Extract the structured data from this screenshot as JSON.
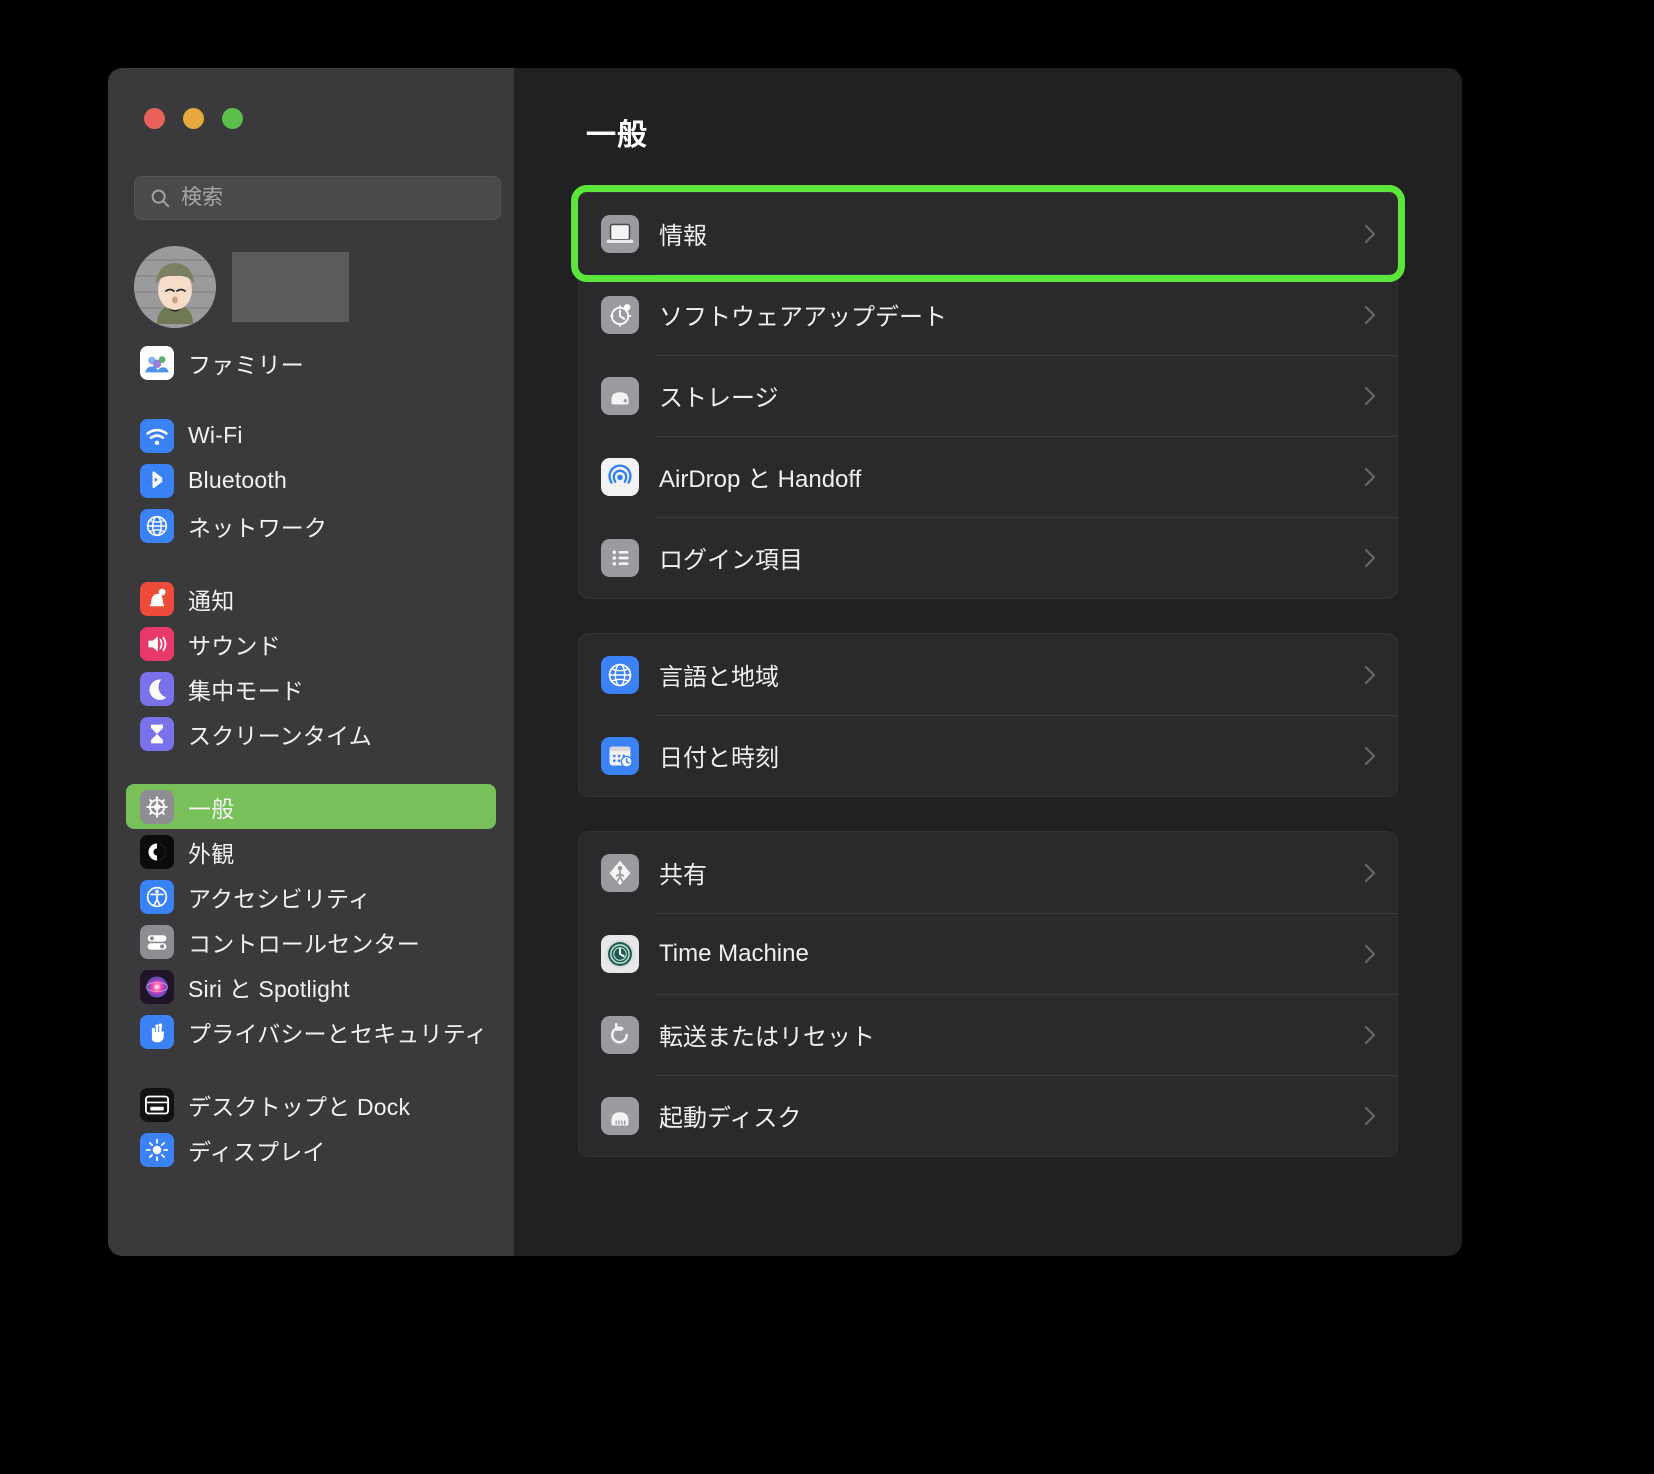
{
  "window": {
    "traffic_lights": [
      {
        "name": "close",
        "color": "#e8615a"
      },
      {
        "name": "minimize",
        "color": "#e7a93d"
      },
      {
        "name": "zoom",
        "color": "#5cbf49"
      }
    ]
  },
  "sidebar": {
    "search": {
      "placeholder": "検索",
      "value": "",
      "icon": "search-icon"
    },
    "account": {
      "avatar_icon": "user-avatar",
      "name_redacted": true
    },
    "groups": [
      {
        "items": [
          {
            "label": "ファミリー",
            "icon": "family-icon",
            "color": "#ffffff",
            "selected": false
          }
        ]
      },
      {
        "items": [
          {
            "label": "Wi-Fi",
            "icon": "wifi-icon",
            "color": "#3b82f6",
            "selected": false
          },
          {
            "label": "Bluetooth",
            "icon": "bluetooth-icon",
            "color": "#3b82f6",
            "selected": false
          },
          {
            "label": "ネットワーク",
            "icon": "globe-icon",
            "color": "#3b82f6",
            "selected": false
          }
        ]
      },
      {
        "items": [
          {
            "label": "通知",
            "icon": "bell-icon",
            "color": "#ef4b3c",
            "selected": false
          },
          {
            "label": "サウンド",
            "icon": "speaker-icon",
            "color": "#e8396a",
            "selected": false
          },
          {
            "label": "集中モード",
            "icon": "moon-icon",
            "color": "#7a72ea",
            "selected": false
          },
          {
            "label": "スクリーンタイム",
            "icon": "hourglass-icon",
            "color": "#7a72ea",
            "selected": false
          }
        ]
      },
      {
        "items": [
          {
            "label": "一般",
            "icon": "gear-icon",
            "color": "#8d8d92",
            "selected": true
          },
          {
            "label": "外観",
            "icon": "appearance-icon",
            "color": "#0b0b0c",
            "selected": false
          },
          {
            "label": "アクセシビリティ",
            "icon": "accessibility-icon",
            "color": "#3b82f6",
            "selected": false
          },
          {
            "label": "コントロールセンター",
            "icon": "control-center-icon",
            "color": "#8d8d92",
            "selected": false
          },
          {
            "label": "Siri と Spotlight",
            "icon": "siri-icon",
            "color": "#2a1c33",
            "selected": false
          },
          {
            "label": "プライバシーとセキュリティ",
            "icon": "hand-icon",
            "color": "#3b82f6",
            "selected": false
          }
        ]
      },
      {
        "items": [
          {
            "label": "デスクトップと Dock",
            "icon": "desktop-dock-icon",
            "color": "#131314",
            "selected": false
          },
          {
            "label": "ディスプレイ",
            "icon": "display-icon",
            "color": "#3b82f6",
            "selected": false
          }
        ]
      }
    ]
  },
  "main": {
    "title": "一般",
    "highlight_color": "#5ce63c",
    "groups": [
      {
        "rows": [
          {
            "label": "情報",
            "icon": "laptop-icon",
            "color": "#9a9a9f",
            "chevron": "chevron-right-icon",
            "highlighted": true
          },
          {
            "label": "ソフトウェアアップデート",
            "icon": "software-update-icon",
            "color": "#9a9a9f",
            "chevron": "chevron-right-icon",
            "highlighted": false
          },
          {
            "label": "ストレージ",
            "icon": "storage-icon",
            "color": "#9a9a9f",
            "chevron": "chevron-right-icon",
            "highlighted": false
          },
          {
            "label": "AirDrop と Handoff",
            "icon": "airdrop-icon",
            "color": "#f2f2f4",
            "chevron": "chevron-right-icon",
            "highlighted": false
          },
          {
            "label": "ログイン項目",
            "icon": "login-items-icon",
            "color": "#9a9a9f",
            "chevron": "chevron-right-icon",
            "highlighted": false
          }
        ]
      },
      {
        "rows": [
          {
            "label": "言語と地域",
            "icon": "language-region-icon",
            "color": "#3b82f6",
            "chevron": "chevron-right-icon",
            "highlighted": false
          },
          {
            "label": "日付と時刻",
            "icon": "date-time-icon",
            "color": "#3b82f6",
            "chevron": "chevron-right-icon",
            "highlighted": false
          }
        ]
      },
      {
        "rows": [
          {
            "label": "共有",
            "icon": "sharing-icon",
            "color": "#9a9a9f",
            "chevron": "chevron-right-icon",
            "highlighted": false
          },
          {
            "label": "Time Machine",
            "icon": "time-machine-icon",
            "color": "#1e5c52",
            "chevron": "chevron-right-icon",
            "highlighted": false
          },
          {
            "label": "転送またはリセット",
            "icon": "transfer-reset-icon",
            "color": "#9a9a9f",
            "chevron": "chevron-right-icon",
            "highlighted": false
          },
          {
            "label": "起動ディスク",
            "icon": "startup-disk-icon",
            "color": "#9a9a9f",
            "chevron": "chevron-right-icon",
            "highlighted": false
          }
        ]
      }
    ]
  }
}
